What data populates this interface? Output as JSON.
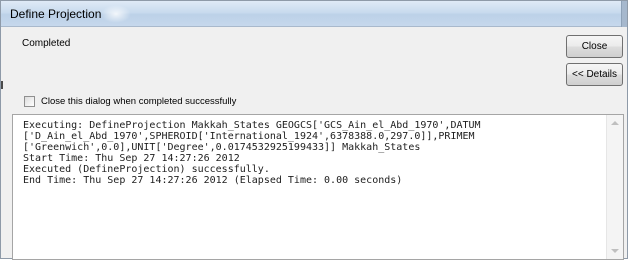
{
  "window": {
    "title": "Define Projection"
  },
  "status": {
    "text": "Completed"
  },
  "buttons": {
    "close_label": "Close",
    "details_label": "<< Details"
  },
  "checkbox": {
    "label": "Close this dialog when completed successfully",
    "checked": false
  },
  "log": {
    "lines": [
      "Executing: DefineProjection Makkah_States GEOGCS['GCS_Ain_el_Abd_1970',DATUM",
      "['D_Ain_el_Abd_1970',SPHEROID['International_1924',6378388.0,297.0]],PRIMEM",
      "['Greenwich',0.0],UNIT['Degree',0.0174532925199433]] Makkah_States",
      "Start Time: Thu Sep 27 14:27:26 2012",
      "Executed (DefineProjection) successfully.",
      "End Time: Thu Sep 27 14:27:26 2012 (Elapsed Time: 0.00 seconds)"
    ]
  },
  "icons": {
    "scroll_up": "scroll-up-arrow-icon",
    "scroll_down": "scroll-down-arrow-icon"
  },
  "colors": {
    "titlebar": "#c9dbee",
    "dialog_bg": "#f0f0f0",
    "log_bg": "#ffffff"
  }
}
